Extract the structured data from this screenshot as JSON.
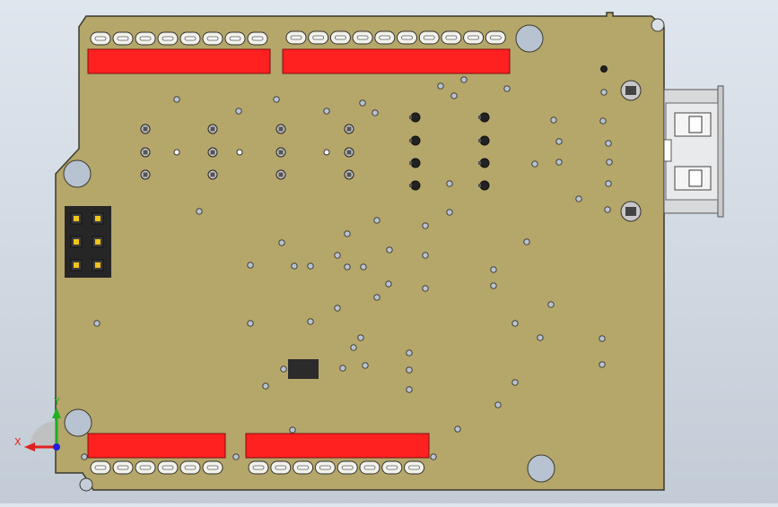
{
  "viewport": {
    "background": "#d3dbe4"
  },
  "board": {
    "color": "#b5a66a",
    "outline": "#3a3a2e",
    "header_color": "#ff2020",
    "hole_color": "#b8c3d1",
    "chip_color": "#2b2b2b",
    "header_pin_count_top_left": 8,
    "header_pin_count_top_right": 10,
    "header_pin_count_bottom_left": 6,
    "header_pin_count_bottom_right": 8,
    "icsp_pin_count": 6
  },
  "usb_connector": {
    "color": "#d9dadb",
    "present": true
  },
  "axis_triad": {
    "x_label": "X",
    "y_label": "Y",
    "x_color": "#e02020",
    "y_color": "#20b020",
    "z_color": "#2020e0"
  }
}
